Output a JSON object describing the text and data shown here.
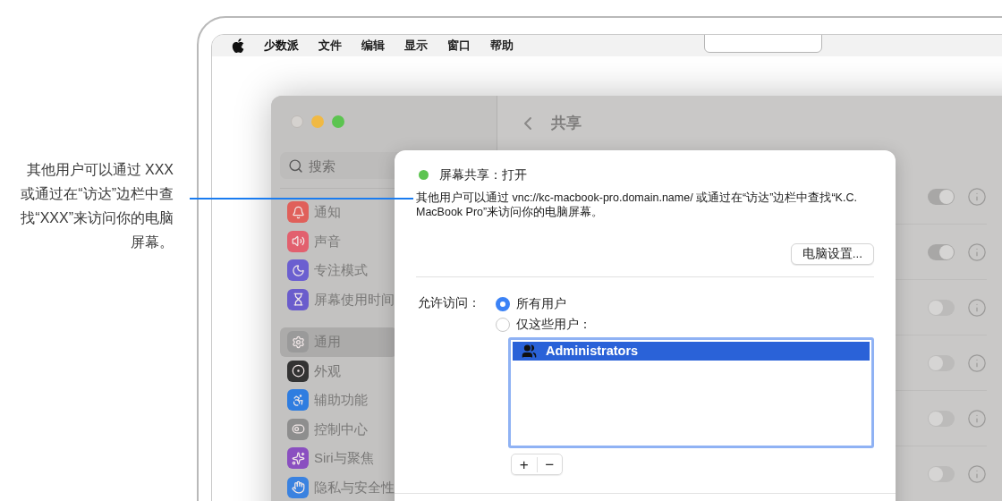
{
  "callout": {
    "text": "其他用户可以通过 XXX 或通过在“访达”边栏中查找“XXX”来访问你的电脑屏幕。"
  },
  "menu_bar": {
    "app_name": "少数派",
    "items": [
      "文件",
      "编辑",
      "显示",
      "窗口",
      "帮助"
    ]
  },
  "window": {
    "title": "共享"
  },
  "sidebar": {
    "search": {
      "placeholder": "搜索"
    },
    "groups": [
      [
        {
          "label": "通知",
          "color": "#e0605a",
          "selected": false
        },
        {
          "label": "声音",
          "color": "#e2606e",
          "selected": false
        },
        {
          "label": "专注模式",
          "color": "#6b5fd0",
          "selected": false
        },
        {
          "label": "屏幕使用时间",
          "color": "#6a5ccc",
          "selected": false
        }
      ],
      [
        {
          "label": "通用",
          "color": "#9a9a9a",
          "selected": true
        },
        {
          "label": "外观",
          "color": "#333333",
          "selected": false
        },
        {
          "label": "辅助功能",
          "color": "#2f7de0",
          "selected": false
        },
        {
          "label": "控制中心",
          "color": "#8e8e8e",
          "selected": false
        },
        {
          "label": "Siri与聚焦",
          "color": "#8a4fc0",
          "selected": false
        },
        {
          "label": "隐私与安全性",
          "color": "#3a82e0",
          "selected": false
        }
      ]
    ]
  },
  "service_rows": [
    {
      "on": true
    },
    {
      "on": true
    },
    {
      "on": false
    },
    {
      "on": false
    },
    {
      "on": false
    },
    {
      "on": false
    }
  ],
  "sheet": {
    "status": {
      "on": true,
      "title": "屏幕共享：打开"
    },
    "description": "其他用户可以通过 vnc://kc-macbook-pro.domain.name/ 或通过在“访达”边栏中查找“K.C. MacBook Pro”来访问你的电脑屏幕。",
    "settings_button": "电脑设置...",
    "access_label": "允许访问：",
    "access_options": [
      {
        "label": "所有用户",
        "selected": true
      },
      {
        "label": "仅这些用户：",
        "selected": false
      }
    ],
    "users": [
      {
        "name": "Administrators",
        "selected": true
      }
    ],
    "add_button": "+",
    "remove_button": "−"
  }
}
